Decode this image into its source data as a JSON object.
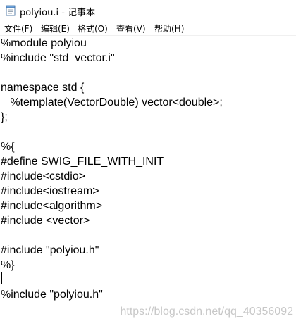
{
  "window": {
    "title": "polyiou.i - 记事本",
    "app_icon": "notepad-icon"
  },
  "menu": {
    "items": [
      {
        "label": "文件(F)"
      },
      {
        "label": "编辑(E)"
      },
      {
        "label": "格式(O)"
      },
      {
        "label": "查看(V)"
      },
      {
        "label": "帮助(H)"
      }
    ]
  },
  "editor": {
    "lines": [
      "%module polyiou",
      "%include \"std_vector.i\"",
      "",
      "namespace std {",
      "   %template(VectorDouble) vector<double>;",
      "};",
      "",
      "%{",
      "#define SWIG_FILE_WITH_INIT",
      "#include<cstdio>",
      "#include<iostream>",
      "#include<algorithm>",
      "#include <vector>",
      "",
      "#include \"polyiou.h\"",
      "%}",
      "",
      "%include \"polyiou.h\""
    ]
  },
  "watermark": {
    "text": "https://blog.csdn.net/qq_40356092"
  }
}
